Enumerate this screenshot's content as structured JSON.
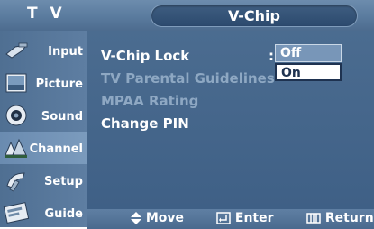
{
  "header": {
    "source_label": "T V",
    "menu_title": "V-Chip"
  },
  "sidebar": {
    "items": [
      {
        "label": "Input",
        "icon": "input-icon",
        "active": false
      },
      {
        "label": "Picture",
        "icon": "picture-icon",
        "active": false
      },
      {
        "label": "Sound",
        "icon": "sound-icon",
        "active": false
      },
      {
        "label": "Channel",
        "icon": "channel-icon",
        "active": true
      },
      {
        "label": "Setup",
        "icon": "setup-icon",
        "active": false
      },
      {
        "label": "Guide",
        "icon": "guide-icon",
        "active": false
      }
    ]
  },
  "main": {
    "items": [
      {
        "label": "V-Chip Lock",
        "enabled": true
      },
      {
        "label": "TV Parental Guidelines",
        "enabled": false
      },
      {
        "label": "MPAA Rating",
        "enabled": false
      },
      {
        "label": "Change PIN",
        "enabled": true
      }
    ],
    "separator": ":",
    "dropdown": {
      "options": [
        "Off",
        "On"
      ],
      "selected": "Off"
    }
  },
  "footer": {
    "move": "Move",
    "enter": "Enter",
    "return": "Return"
  },
  "colors": {
    "header": "#5a7b9e",
    "panel": "#4b6c90",
    "highlight": "#7896b8",
    "disabled_text": "#8ea8c3"
  }
}
